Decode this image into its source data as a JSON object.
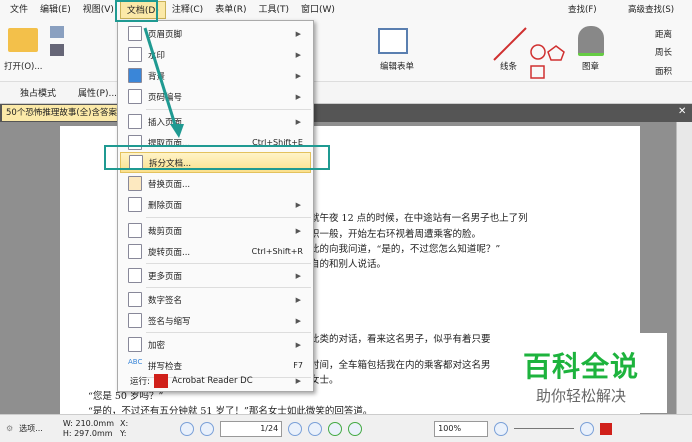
{
  "menubar": [
    "文件",
    "编辑(E)",
    "视图(V)",
    "文档(D)",
    "注释(C)",
    "表单(R)",
    "工具(T)",
    "窗口(W)"
  ],
  "ribbon": {
    "open": "打开(O)...",
    "edit_form": "编辑表单",
    "lines": "线条",
    "stamp": "图章",
    "distance": "距离",
    "perimeter": "周长",
    "area": "面积",
    "find": "查找(F)",
    "adv_find": "高级查找(S)"
  },
  "row2": {
    "exclusive": "独占模式",
    "properties": "属性(P)..."
  },
  "doc_tab": "50个恐怖推理故事(全)含答案",
  "menu": {
    "items": [
      {
        "label": "页眉页脚",
        "sub": true
      },
      {
        "label": "水印",
        "sub": true
      },
      {
        "label": "背景",
        "sub": true
      },
      {
        "label": "页码编号",
        "sub": true
      },
      {
        "label": "插入页面",
        "sub": true
      },
      {
        "label": "提取页面...",
        "shortcut": "Ctrl+Shift+E"
      },
      {
        "label": "拆分文档..."
      },
      {
        "label": "替换页面..."
      },
      {
        "label": "删除页面",
        "sub": true
      },
      {
        "label": "裁剪页面",
        "sub": true
      },
      {
        "label": "旋转页面...",
        "shortcut": "Ctrl+Shift+R"
      },
      {
        "label": "更多页面",
        "sub": true
      },
      {
        "label": "数字签名",
        "sub": true
      },
      {
        "label": "签名与缩写",
        "sub": true
      },
      {
        "label": "加密",
        "sub": true
      },
      {
        "label": "拼写检查",
        "shortcut": "F7"
      },
      {
        "label": "运行:",
        "app": "Acrobat Reader DC",
        "sub": true
      }
    ]
  },
  "doc_text": [
    "就午夜 12 点的时候，在中途站有一名男子也上了列",
    "识一般，开始左右环视着周遭乘客的脸。",
    "此的向我问道，“是的，不过您怎么知道呢？”",
    "自的和别人说话。",
    "此类的对话，看来这名男子，似乎有着只要",
    "时间，全车箱包括我在内的乘客都对这名男",
    "女士。",
    "“您是 50 岁吗？”",
    "“是的，不过还有五分钟就 51 岁了！”那名女士如此微笑的回答道。"
  ],
  "watermark": {
    "title": "百科全说",
    "subtitle": "助你轻松解决"
  },
  "status": {
    "options": "选项...",
    "w": "W: 210.0mm",
    "h": "H: 297.0mm",
    "x": "X:",
    "y": "Y:",
    "page": "1/24",
    "zoom": "100%"
  },
  "colors": {
    "highlight": "#1f9a92",
    "menu_hl": "#fbe08c"
  }
}
